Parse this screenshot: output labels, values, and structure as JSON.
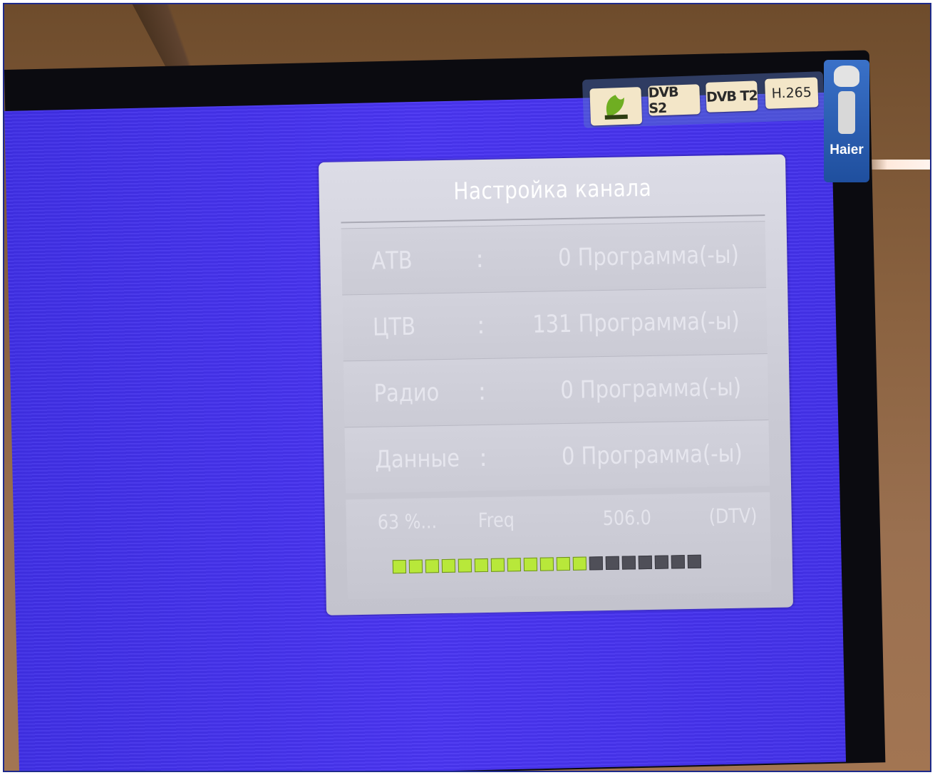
{
  "badges": {
    "dvbs2": "DVB S2",
    "dvbt2": "DVB T2",
    "h265": "H.265"
  },
  "brand": "Haier",
  "menu": {
    "title": "Настройка канала",
    "rows": [
      {
        "label": "АТВ",
        "separator": ":",
        "value": "0 Программа(-ы)"
      },
      {
        "label": "ЦТВ",
        "separator": ":",
        "value": "131 Программа(-ы)"
      },
      {
        "label": "Радио",
        "separator": ":",
        "value": "0 Программа(-ы)"
      },
      {
        "label": "Данные",
        "separator": ":",
        "value": "0 Программа(-ы)"
      }
    ],
    "status": {
      "percent": "63 %...",
      "freq_label": "Freq",
      "freq_value": "506.0",
      "mode": "(DTV)"
    },
    "progress": {
      "segments_total": 19,
      "segments_filled": 12,
      "filled_color": "#b8e83a",
      "empty_color": "#4f4f58"
    }
  },
  "colors": {
    "screen_blue": "#4433ee",
    "panel_gray": "#cfcfd9"
  }
}
